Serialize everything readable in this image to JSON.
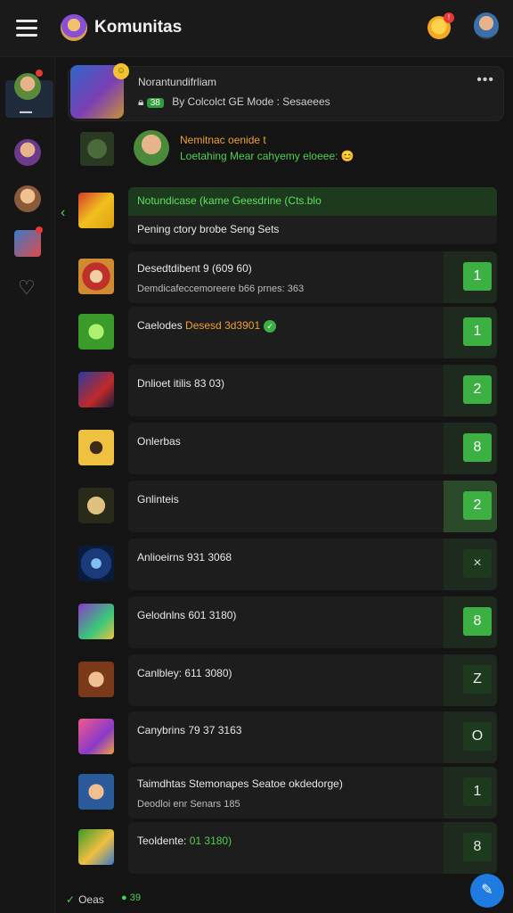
{
  "app": {
    "title": "Komunitas"
  },
  "colors": {
    "accent_green": "#3cb043",
    "accent_orange": "#f0a030",
    "fab_blue": "#1e7ce0"
  },
  "topbar": {
    "menu_icon": "hamburger-icon",
    "notif_badge": "!",
    "avatar_icon": "user-avatar"
  },
  "sidebar": {
    "active_label": ""
  },
  "header": {
    "title": "Norantundifrliam",
    "chip": "38",
    "subtitle": "By Colcolct GE Mode : Sesaeees",
    "more": "•••"
  },
  "notice": {
    "line1": "Nemitnac oenide t",
    "line2": "Loetahing Mear cahyemy eloeee: 😊"
  },
  "highlight": {
    "title": "Notundicase (kame Geesdrine (Cts.blo",
    "subtitle": "Pening ctory brobe Seng Sets"
  },
  "rows": [
    {
      "text": "Desedtdibent 9 (609 60)",
      "sub": "Demdicafeccemoreere b66 prnes: 363",
      "rank": "1"
    },
    {
      "text": "Caelodes ",
      "accent": "Desesd 3d3901",
      "rank": "1"
    },
    {
      "text": "Dnlioet itilis 83 03)",
      "rank": "2"
    },
    {
      "text": "Onlerbas",
      "rank": "8"
    },
    {
      "text": "Gnlinteis",
      "rank": "2"
    },
    {
      "text": "Anlioeirns 931 3068",
      "rank": "×"
    },
    {
      "text": "Gelodnlns 601 3180)",
      "rank": "8"
    },
    {
      "text": "Canlbley: 611 3080)",
      "rank": "Z"
    },
    {
      "text": "Canybrins 79 37 3163",
      "rank": "O"
    },
    {
      "text": "Taimdhtas Stemonapes Seatoe okdedorge)",
      "sub": "Deodloi enr Senars 185",
      "rank": "1"
    },
    {
      "text": "Teoldente: ",
      "accent_green": "01 3180)",
      "rank": "8"
    }
  ],
  "footer": {
    "status": "Oeas",
    "chip": "39"
  },
  "fab": {
    "icon": "compose-icon"
  }
}
